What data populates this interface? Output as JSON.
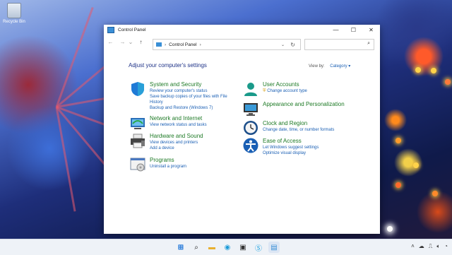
{
  "desktop": {
    "recycle_bin_label": "Recycle Bin"
  },
  "window": {
    "title": "Control Panel",
    "minimize": "—",
    "maximize": "☐",
    "close": "✕"
  },
  "nav": {
    "back": "←",
    "forward": "→",
    "recent": "⌄",
    "up": "↑",
    "address": "Control Panel",
    "address_sep1": "›",
    "address_sep2": "›",
    "dropdown": "⌄",
    "refresh": "↻",
    "search_icon": "⌕",
    "search_placeholder": ""
  },
  "content": {
    "heading": "Adjust your computer's settings",
    "view_by_label": "View by:",
    "view_by_value": "Category ▾",
    "left": [
      {
        "title": "System and Security",
        "links": [
          "Review your computer's status",
          "Save backup copies of your files with File History",
          "Backup and Restore (Windows 7)"
        ],
        "icon": "shield-icon"
      },
      {
        "title": "Network and Internet",
        "links": [
          "View network status and tasks"
        ],
        "icon": "network-icon"
      },
      {
        "title": "Hardware and Sound",
        "links": [
          "View devices and printers",
          "Add a device"
        ],
        "icon": "printer-icon"
      },
      {
        "title": "Programs",
        "links": [
          "Uninstall a program"
        ],
        "icon": "programs-icon"
      }
    ],
    "right": [
      {
        "title": "User Accounts",
        "links": [
          "Change account type"
        ],
        "icon": "user-icon"
      },
      {
        "title": "Appearance and Personalization",
        "links": [],
        "icon": "monitor-icon"
      },
      {
        "title": "Clock and Region",
        "links": [
          "Change date, time, or number formats"
        ],
        "icon": "clock-icon"
      },
      {
        "title": "Ease of Access",
        "links": [
          "Let Windows suggest settings",
          "Optimize visual display"
        ],
        "icon": "accessibility-icon"
      }
    ]
  },
  "colors": {
    "accent": "#1a5fb4",
    "heading": "#1e3287",
    "category_title": "#1e7a26"
  }
}
